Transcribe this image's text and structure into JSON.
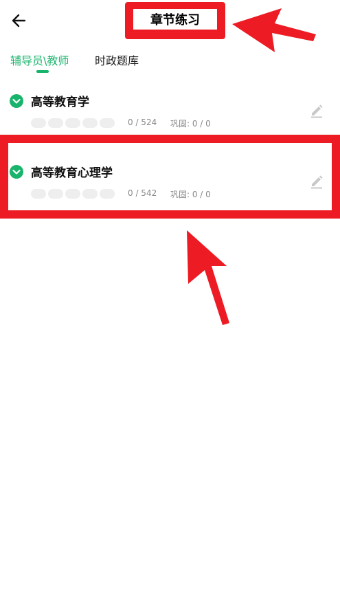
{
  "header": {
    "title": "章节练习"
  },
  "tabs": [
    {
      "label": "辅导员\\教师",
      "active": true
    },
    {
      "label": "时政题库",
      "active": false
    }
  ],
  "chapters": [
    {
      "name": "高等教育学",
      "count": "0 / 524",
      "review": "巩固: 0 / 0",
      "progress": 0
    },
    {
      "name": "高等教育心理学",
      "count": "0 / 542",
      "review": "巩固: 0 / 0",
      "progress": 0
    }
  ],
  "colors": {
    "accent": "#18b46b",
    "annotation": "#ed1c24"
  },
  "icons": {
    "back": "back-arrow-icon",
    "check": "check-circle-icon",
    "edit": "pencil-icon"
  }
}
